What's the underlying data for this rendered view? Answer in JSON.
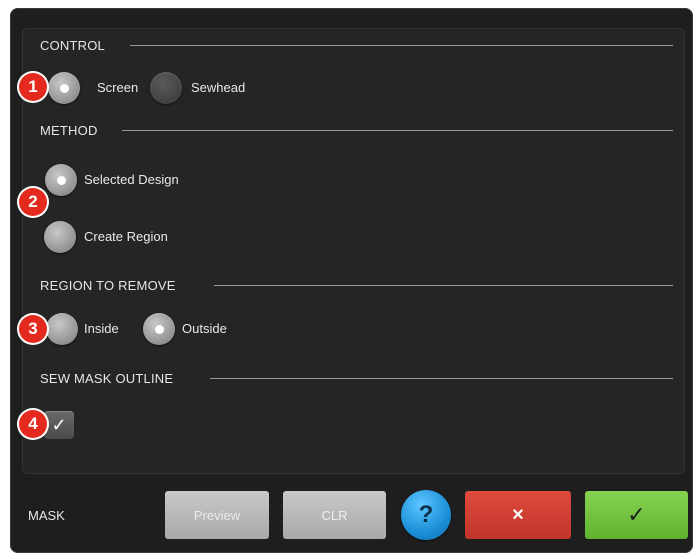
{
  "sections": {
    "control": {
      "title": "CONTROL",
      "options": [
        {
          "label": "Screen",
          "selected": true
        },
        {
          "label": "Sewhead",
          "selected": false
        }
      ]
    },
    "method": {
      "title": "METHOD",
      "options": [
        {
          "label": "Selected Design",
          "selected": true
        },
        {
          "label": "Create Region",
          "selected": false
        }
      ]
    },
    "region": {
      "title": "REGION TO REMOVE",
      "options": [
        {
          "label": "Inside",
          "selected": false
        },
        {
          "label": "Outside",
          "selected": true
        }
      ]
    },
    "sew_mask": {
      "title": "SEW MASK OUTLINE",
      "checked": true,
      "check_glyph": "✓"
    }
  },
  "callouts": [
    "1",
    "2",
    "3",
    "4"
  ],
  "footer": {
    "label": "MASK",
    "preview": "Preview",
    "clr": "CLR",
    "help": "?",
    "cancel": "×",
    "ok": "✓"
  },
  "colors": {
    "callout": "#e42a1e",
    "cancel": "#d0402f",
    "ok": "#72c43e",
    "help": "#1c8fd8"
  }
}
